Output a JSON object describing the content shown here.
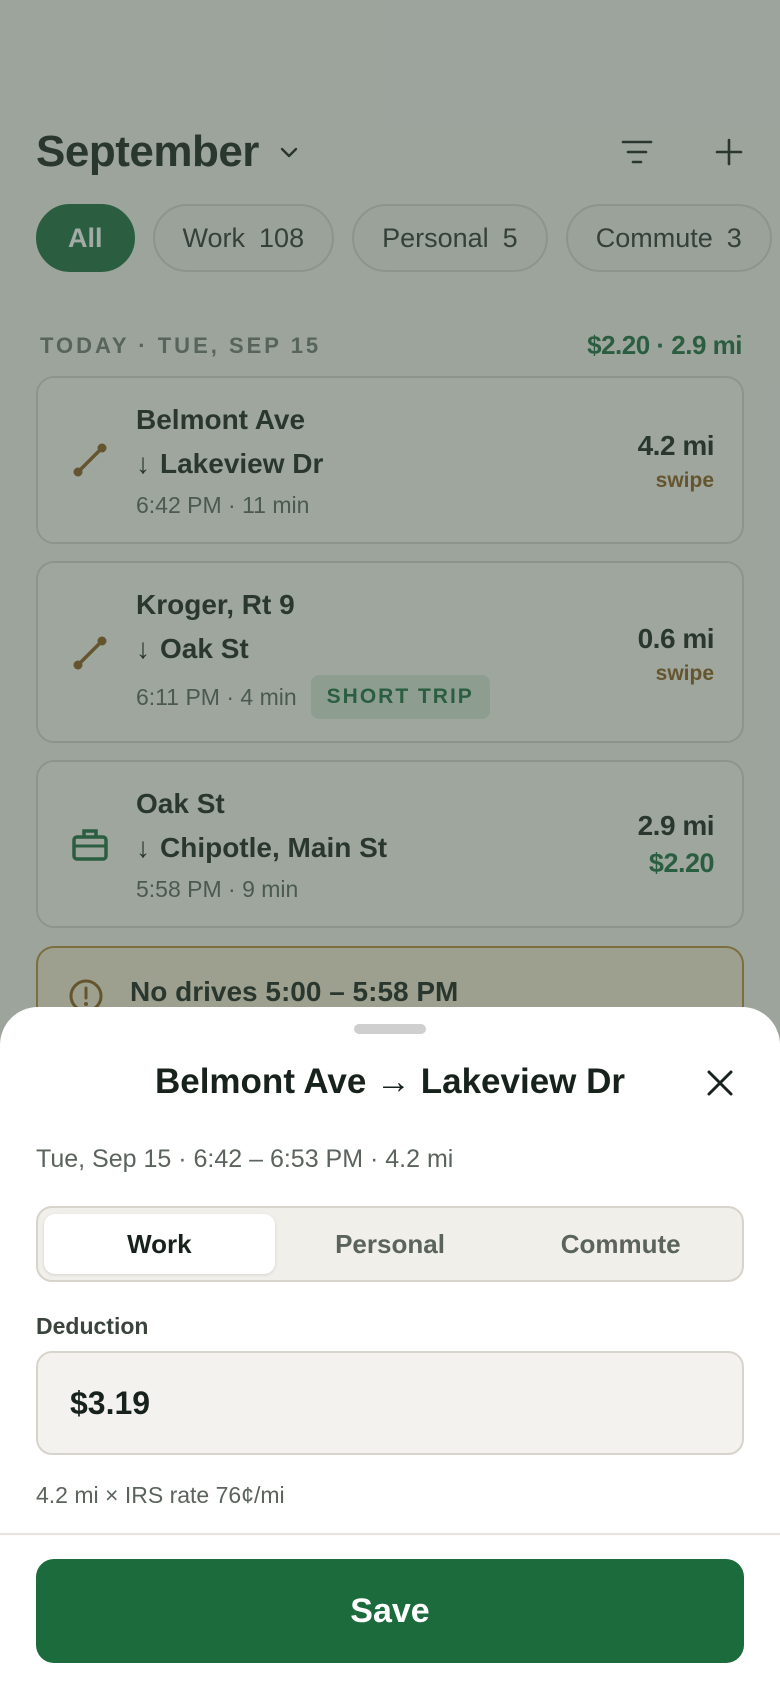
{
  "header": {
    "month": "September"
  },
  "chips": [
    {
      "label": "All",
      "count": ""
    },
    {
      "label": "Work",
      "count": "108"
    },
    {
      "label": "Personal",
      "count": "5"
    },
    {
      "label": "Commute",
      "count": "3"
    }
  ],
  "section": {
    "label": "TODAY · TUE, SEP 15",
    "total": "$2.20 · 2.9 mi"
  },
  "trips": [
    {
      "from": "Belmont Ave",
      "arrow": "↓",
      "to": "Lakeview Dr",
      "meta": "6:42 PM · 11 min",
      "badge": "",
      "distance": "4.2 mi",
      "sub": "swipe",
      "icon": "route-icon"
    },
    {
      "from": "Kroger, Rt 9",
      "arrow": "↓",
      "to": "Oak St",
      "meta": "6:11 PM · 4 min",
      "badge": "SHORT TRIP",
      "distance": "0.6 mi",
      "sub": "swipe",
      "icon": "route-icon"
    },
    {
      "from": "Oak St",
      "arrow": "↓",
      "to": "Chipotle, Main St",
      "meta": "5:58 PM · 9 min",
      "badge": "",
      "distance": "2.9 mi",
      "sub": "$2.20",
      "icon": "briefcase-icon"
    }
  ],
  "warning": {
    "text": "No drives 5:00 – 5:58 PM"
  },
  "sheet": {
    "title": "Belmont Ave → Lakeview Dr",
    "meta": "Tue, Sep 15 · 6:42 – 6:53 PM · 4.2 mi",
    "segments": [
      "Work",
      "Personal",
      "Commute"
    ],
    "selected_segment": "Work",
    "deduction_label": "Deduction",
    "deduction_value": "$3.19",
    "helper": "4.2 mi × IRS rate 76¢/mi",
    "save_label": "Save"
  },
  "colors": {
    "brand_green": "#1b6b3d",
    "warning_amber": "#b68a3a",
    "swipe_brown": "#8a5a1c"
  }
}
